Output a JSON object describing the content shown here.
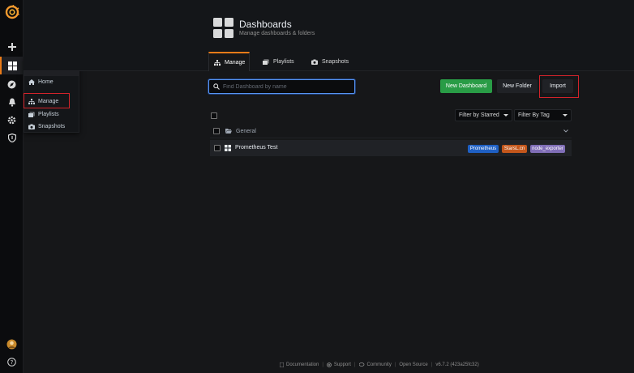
{
  "menu": {
    "title": "Dashboards",
    "items": [
      {
        "label": "Home",
        "icon": "home-icon"
      },
      {
        "label": "Manage",
        "icon": "sitemap-icon"
      },
      {
        "label": "Playlists",
        "icon": "playlist-icon"
      },
      {
        "label": "Snapshots",
        "icon": "snapshot-icon"
      }
    ]
  },
  "header": {
    "title": "Dashboards",
    "subtitle": "Manage dashboards & folders"
  },
  "tabs": [
    {
      "label": "Manage",
      "icon": "sitemap-icon"
    },
    {
      "label": "Playlists",
      "icon": "playlist-icon"
    },
    {
      "label": "Snapshots",
      "icon": "snapshot-icon"
    }
  ],
  "search": {
    "placeholder": "Find Dashboard by name"
  },
  "actions": {
    "new_dashboard": "New Dashboard",
    "new_folder": "New Folder",
    "import": "Import"
  },
  "filters": {
    "starred": "Filter by Starred",
    "tag": "Filter By Tag"
  },
  "folder": {
    "name": "General"
  },
  "dashboard": {
    "title": "Prometheus Test",
    "tags": [
      {
        "label": "Prometheus",
        "color": "#1f60c4"
      },
      {
        "label": "StarsL.cn",
        "color": "#e0752d"
      },
      {
        "label": "node_exporter",
        "color": "#806eb7"
      }
    ]
  },
  "footer": {
    "documentation": "Documentation",
    "support": "Support",
    "community": "Community",
    "open_source": "Open Source",
    "version": "v6.7.2 (423a25fc32)"
  },
  "colors": {
    "accent": "#eb7b18",
    "primary_button": "#299c46",
    "highlight": "#d2232a",
    "focus": "#5794f2"
  }
}
